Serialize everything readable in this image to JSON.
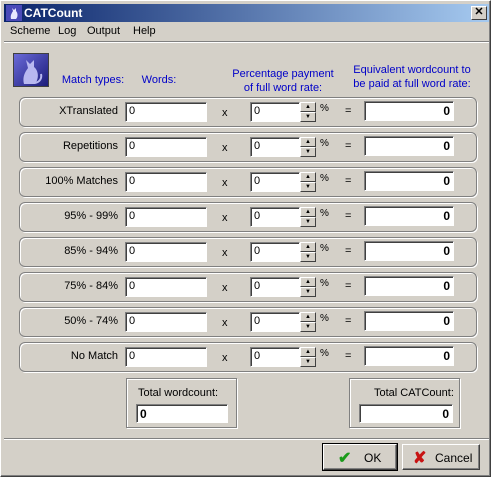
{
  "window": {
    "title": "CATCount",
    "close_glyph": "✕"
  },
  "menu": [
    "Scheme",
    "Log",
    "Output",
    "Help"
  ],
  "headers": {
    "match_types": "Match types:",
    "words": "Words:",
    "percentage_line1": "Percentage payment",
    "percentage_line2": "of full word rate:",
    "equivalent_line1": "Equivalent wordcount to",
    "equivalent_line2": "be paid at full word rate:"
  },
  "rows": [
    {
      "label": "XTranslated",
      "words": "0",
      "percentage": "0",
      "result": "0"
    },
    {
      "label": "Repetitions",
      "words": "0",
      "percentage": "0",
      "result": "0"
    },
    {
      "label": "100% Matches",
      "words": "0",
      "percentage": "0",
      "result": "0"
    },
    {
      "label": "95% - 99%",
      "words": "0",
      "percentage": "0",
      "result": "0"
    },
    {
      "label": "85% - 94%",
      "words": "0",
      "percentage": "0",
      "result": "0"
    },
    {
      "label": "75% - 84%",
      "words": "0",
      "percentage": "0",
      "result": "0"
    },
    {
      "label": "50% - 74%",
      "words": "0",
      "percentage": "0",
      "result": "0"
    },
    {
      "label": "No Match",
      "words": "0",
      "percentage": "0",
      "result": "0"
    }
  ],
  "symbols": {
    "times": "x",
    "percent": "%",
    "equals": "="
  },
  "totals": {
    "wordcount_label": "Total wordcount:",
    "wordcount_value": "0",
    "catcount_label": "Total CATCount:",
    "catcount_value": "0"
  },
  "buttons": {
    "ok": "OK",
    "cancel": "Cancel"
  },
  "colors": {
    "header_text": "#0000c8",
    "ok_check": "#1a9a1a",
    "cancel_x": "#c81414",
    "titlebar_start": "#0a246a",
    "titlebar_end": "#a6caf0"
  },
  "icons": {
    "app": "cat-silhouette-icon",
    "ok": "check-icon",
    "cancel": "x-icon"
  }
}
